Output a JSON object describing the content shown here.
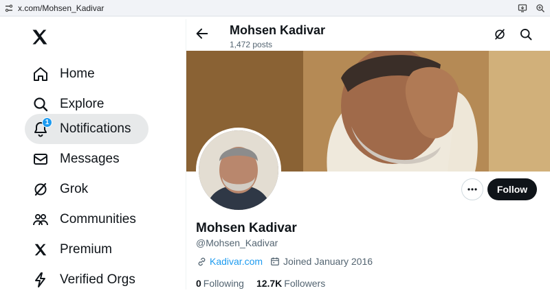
{
  "browser": {
    "url": "x.com/Mohsen_Kadivar"
  },
  "sidebar": {
    "logo": "x-logo",
    "items": [
      {
        "label": "Home",
        "icon": "home-icon"
      },
      {
        "label": "Explore",
        "icon": "search-icon"
      },
      {
        "label": "Notifications",
        "icon": "bell-icon",
        "badge": "1",
        "active": true
      },
      {
        "label": "Messages",
        "icon": "envelope-icon"
      },
      {
        "label": "Grok",
        "icon": "grok-icon"
      },
      {
        "label": "Communities",
        "icon": "people-icon"
      },
      {
        "label": "Premium",
        "icon": "x-logo-icon"
      },
      {
        "label": "Verified Orgs",
        "icon": "lightning-icon"
      }
    ]
  },
  "header": {
    "name": "Mohsen Kadivar",
    "posts": "1,472 posts"
  },
  "profile": {
    "name": "Mohsen Kadivar",
    "handle": "@Mohsen_Kadivar",
    "website": "Kadivar.com",
    "joined": "Joined January 2016",
    "following_count": "0",
    "following_label": "Following",
    "followers_count": "12.7K",
    "followers_label": "Followers",
    "follow_label": "Follow"
  },
  "colors": {
    "accent": "#1d9bf0",
    "text": "#0f1419",
    "muted": "#536471"
  }
}
